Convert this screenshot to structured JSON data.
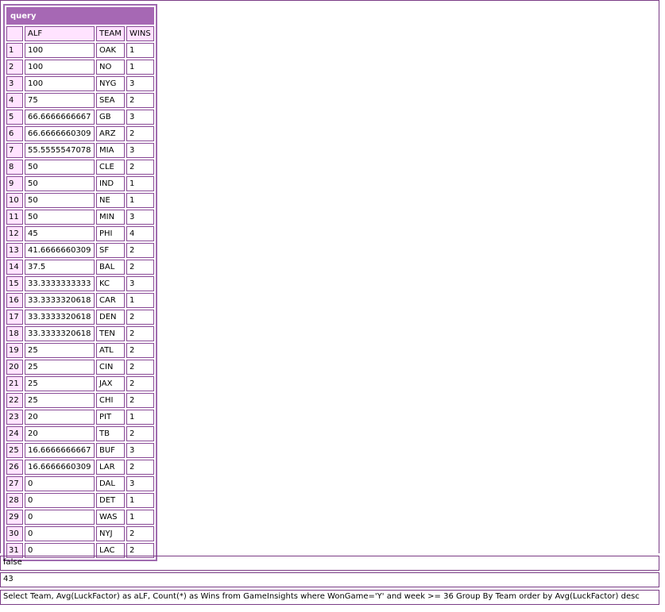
{
  "query": {
    "title": "query",
    "columns": [
      "ALF",
      "TEAM",
      "WINS"
    ],
    "rows": [
      {
        "n": "1",
        "alf": "100",
        "team": "OAK",
        "wins": "1"
      },
      {
        "n": "2",
        "alf": "100",
        "team": "NO",
        "wins": "1"
      },
      {
        "n": "3",
        "alf": "100",
        "team": "NYG",
        "wins": "3"
      },
      {
        "n": "4",
        "alf": "75",
        "team": "SEA",
        "wins": "2"
      },
      {
        "n": "5",
        "alf": "66.6666666667",
        "team": "GB",
        "wins": "3"
      },
      {
        "n": "6",
        "alf": "66.6666660309",
        "team": "ARZ",
        "wins": "2"
      },
      {
        "n": "7",
        "alf": "55.5555547078",
        "team": "MIA",
        "wins": "3"
      },
      {
        "n": "8",
        "alf": "50",
        "team": "CLE",
        "wins": "2"
      },
      {
        "n": "9",
        "alf": "50",
        "team": "IND",
        "wins": "1"
      },
      {
        "n": "10",
        "alf": "50",
        "team": "NE",
        "wins": "1"
      },
      {
        "n": "11",
        "alf": "50",
        "team": "MIN",
        "wins": "3"
      },
      {
        "n": "12",
        "alf": "45",
        "team": "PHI",
        "wins": "4"
      },
      {
        "n": "13",
        "alf": "41.6666660309",
        "team": "SF",
        "wins": "2"
      },
      {
        "n": "14",
        "alf": "37.5",
        "team": "BAL",
        "wins": "2"
      },
      {
        "n": "15",
        "alf": "33.3333333333",
        "team": "KC",
        "wins": "3"
      },
      {
        "n": "16",
        "alf": "33.3333320618",
        "team": "CAR",
        "wins": "1"
      },
      {
        "n": "17",
        "alf": "33.3333320618",
        "team": "DEN",
        "wins": "2"
      },
      {
        "n": "18",
        "alf": "33.3333320618",
        "team": "TEN",
        "wins": "2"
      },
      {
        "n": "19",
        "alf": "25",
        "team": "ATL",
        "wins": "2"
      },
      {
        "n": "20",
        "alf": "25",
        "team": "CIN",
        "wins": "2"
      },
      {
        "n": "21",
        "alf": "25",
        "team": "JAX",
        "wins": "2"
      },
      {
        "n": "22",
        "alf": "25",
        "team": "CHI",
        "wins": "2"
      },
      {
        "n": "23",
        "alf": "20",
        "team": "PIT",
        "wins": "1"
      },
      {
        "n": "24",
        "alf": "20",
        "team": "TB",
        "wins": "2"
      },
      {
        "n": "25",
        "alf": "16.6666666667",
        "team": "BUF",
        "wins": "3"
      },
      {
        "n": "26",
        "alf": "16.6666660309",
        "team": "LAR",
        "wins": "2"
      },
      {
        "n": "27",
        "alf": "0",
        "team": "DAL",
        "wins": "3"
      },
      {
        "n": "28",
        "alf": "0",
        "team": "DET",
        "wins": "1"
      },
      {
        "n": "29",
        "alf": "0",
        "team": "WAS",
        "wins": "1"
      },
      {
        "n": "30",
        "alf": "0",
        "team": "NYJ",
        "wins": "2"
      },
      {
        "n": "31",
        "alf": "0",
        "team": "LAC",
        "wins": "2"
      }
    ]
  },
  "cached": "false",
  "execution_time": "43",
  "sql": "Select Team, Avg(LuckFactor) as aLF, Count(*) as Wins from GameInsights where WonGame='Y' and week >= 36 Group By Team order by Avg(LuckFactor) desc"
}
